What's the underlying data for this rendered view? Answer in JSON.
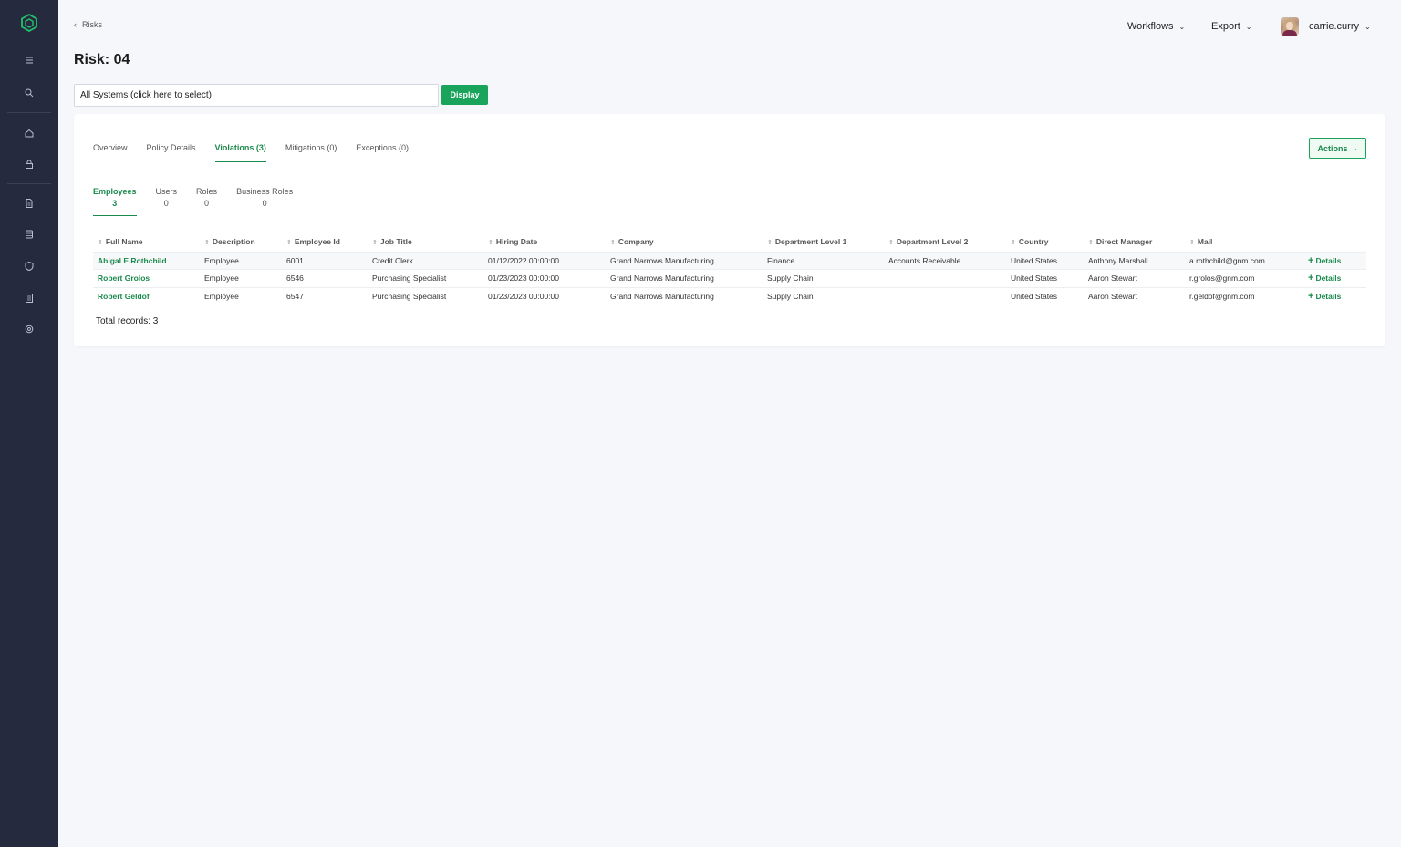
{
  "breadcrumb": {
    "label": "Risks"
  },
  "topnav": {
    "workflows": "Workflows",
    "export": "Export",
    "user": "carrie.curry"
  },
  "page": {
    "title": "Risk: 04"
  },
  "system_select": {
    "value": "All Systems (click here to select)",
    "display_label": "Display"
  },
  "tabs": [
    {
      "label": "Overview"
    },
    {
      "label": "Policy Details"
    },
    {
      "label": "Violations (3)"
    },
    {
      "label": "Mitigations (0)"
    },
    {
      "label": "Exceptions (0)"
    }
  ],
  "actions_label": "Actions",
  "subtabs": [
    {
      "label": "Employees",
      "count": "3"
    },
    {
      "label": "Users",
      "count": "0"
    },
    {
      "label": "Roles",
      "count": "0"
    },
    {
      "label": "Business Roles",
      "count": "0"
    }
  ],
  "table": {
    "headers": [
      "Full Name",
      "Description",
      "Employee Id",
      "Job Title",
      "Hiring Date",
      "Company",
      "Department Level 1",
      "Department Level 2",
      "Country",
      "Direct Manager",
      "Mail"
    ],
    "details_label": "Details",
    "rows": [
      [
        "Abigal E.Rothchild",
        "Employee",
        "6001",
        "Credit Clerk",
        "01/12/2022 00:00:00",
        "Grand Narrows Manufacturing",
        "Finance",
        "Accounts Receivable",
        "United States",
        "Anthony Marshall",
        "a.rothchild@gnm.com"
      ],
      [
        "Robert Grolos",
        "Employee",
        "6546",
        "Purchasing Specialist",
        "01/23/2023 00:00:00",
        "Grand Narrows Manufacturing",
        "Supply Chain",
        "",
        "United States",
        "Aaron Stewart",
        "r.grolos@gnm.com"
      ],
      [
        "Robert Geldof",
        "Employee",
        "6547",
        "Purchasing Specialist",
        "01/23/2023 00:00:00",
        "Grand Narrows Manufacturing",
        "Supply Chain",
        "",
        "United States",
        "Aaron Stewart",
        "r.geldof@gnm.com"
      ]
    ]
  },
  "total_records": "Total records: 3",
  "colors": {
    "sidebar": "#252a3f",
    "accent": "#1aa35a",
    "background": "#f6f7fb"
  },
  "sidebar_icons": [
    "logo-icon",
    "menu-icon",
    "search-icon",
    "home-icon",
    "lock-icon",
    "document-icon",
    "database-icon",
    "shield-icon",
    "report-icon",
    "settings-icon"
  ]
}
